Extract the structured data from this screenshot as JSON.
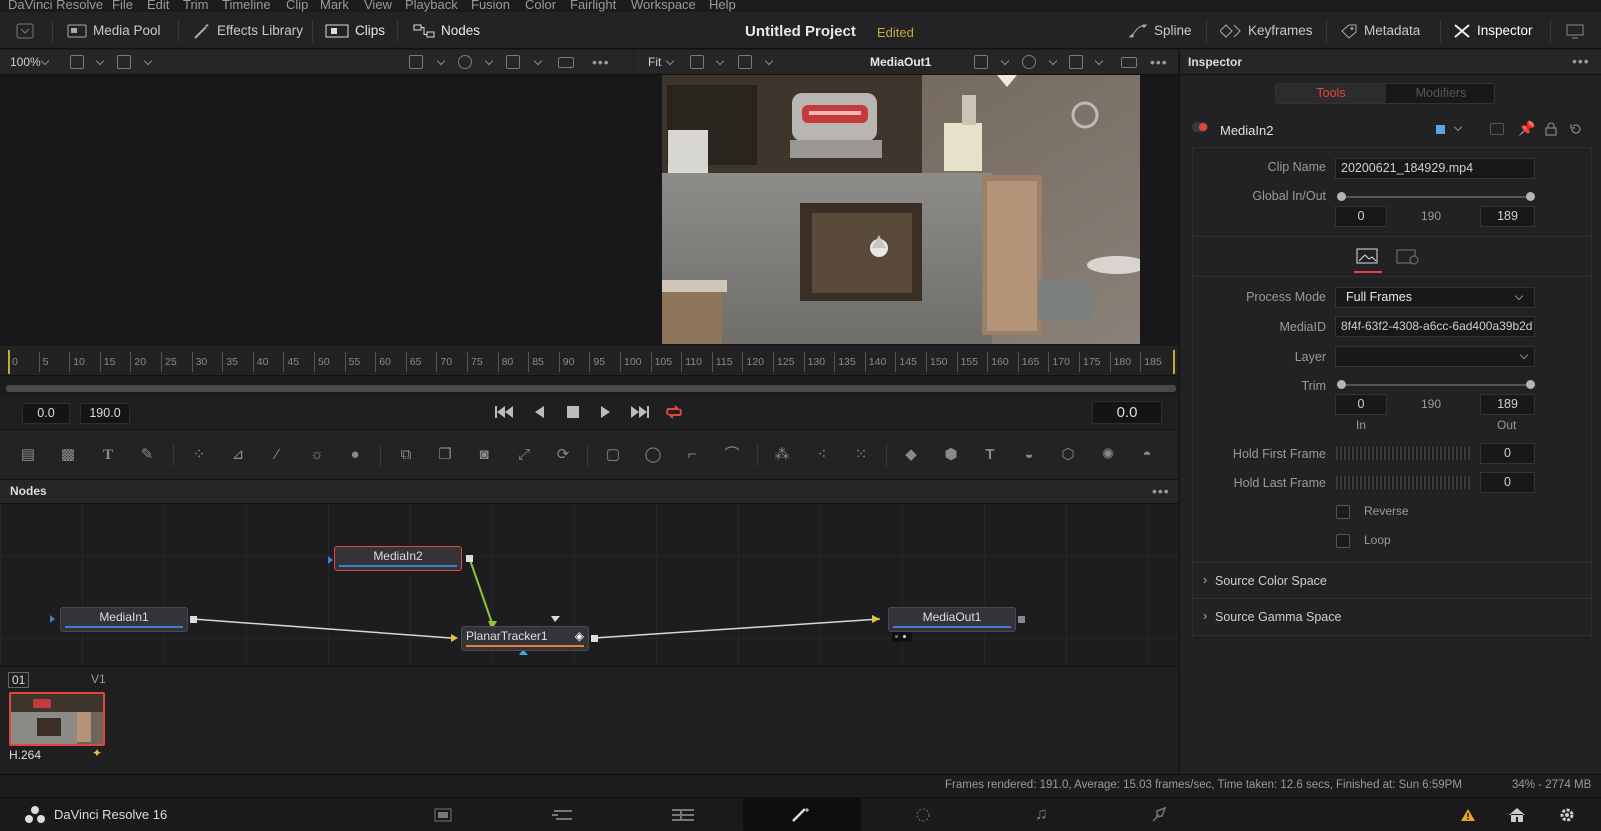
{
  "menu": [
    "DaVinci Resolve",
    "File",
    "Edit",
    "Trim",
    "Timeline",
    "Clip",
    "Mark",
    "View",
    "Playback",
    "Fusion",
    "Color",
    "Fairlight",
    "Workspace",
    "Help"
  ],
  "toolbar": {
    "media_pool": "Media Pool",
    "effects_library": "Effects Library",
    "clips": "Clips",
    "nodes": "Nodes",
    "project_title": "Untitled Project",
    "edited": "Edited",
    "spline": "Spline",
    "keyframes": "Keyframes",
    "metadata": "Metadata",
    "inspector": "Inspector"
  },
  "viewer_left": {
    "zoom": "100%"
  },
  "viewer_right": {
    "fit": "Fit",
    "name": "MediaOut1"
  },
  "ruler": {
    "ticks": [
      "0",
      "5",
      "10",
      "15",
      "20",
      "25",
      "30",
      "35",
      "40",
      "45",
      "50",
      "55",
      "60",
      "65",
      "70",
      "75",
      "80",
      "85",
      "90",
      "95",
      "100",
      "105",
      "110",
      "115",
      "120",
      "125",
      "130",
      "135",
      "140",
      "145",
      "150",
      "155",
      "160",
      "165",
      "170",
      "175",
      "180",
      "185"
    ]
  },
  "transport": {
    "in": "0.0",
    "out": "190.0",
    "current": "0.0"
  },
  "nodes_panel": {
    "title": "Nodes",
    "nodes": {
      "mediain2": "MediaIn2",
      "mediain1": "MediaIn1",
      "tracker": "PlanarTracker1",
      "mediaout1": "MediaOut1"
    }
  },
  "clips": {
    "index": "01",
    "track": "V1",
    "codec": "H.264"
  },
  "status": {
    "render": "Frames rendered: 191.0,  Average: 15.03 frames/sec,  Time taken: 12.6 secs,  Finished at: Sun 6:59PM",
    "memory": "34% - 2774 MB"
  },
  "pagebar": {
    "app": "DaVinci Resolve 16"
  },
  "inspector": {
    "title": "Inspector",
    "tab_tools": "Tools",
    "tab_modifiers": "Modifiers",
    "tool_name": "MediaIn2",
    "clip_name_label": "Clip Name",
    "clip_name": "20200621_184929.mp4",
    "global_label": "Global In/Out",
    "global_in": "0",
    "global_mid": "190",
    "global_out": "189",
    "process_mode_label": "Process Mode",
    "process_mode": "Full Frames",
    "mediaid_label": "MediaID",
    "mediaid": "8f4f-63f2-4308-a6cc-6ad400a39b2d",
    "layer_label": "Layer",
    "trim_label": "Trim",
    "trim_in": "0",
    "trim_mid": "190",
    "trim_out": "189",
    "in_label": "In",
    "out_label": "Out",
    "hold_first_label": "Hold First Frame",
    "hold_first": "0",
    "hold_last_label": "Hold Last Frame",
    "hold_last": "0",
    "reverse": "Reverse",
    "loop": "Loop",
    "source_color": "Source Color Space",
    "source_gamma": "Source Gamma Space"
  },
  "colors": {
    "accent_red": "#e0463c",
    "accent_blue": "#3c7fd0",
    "edited": "#c9a83a"
  }
}
